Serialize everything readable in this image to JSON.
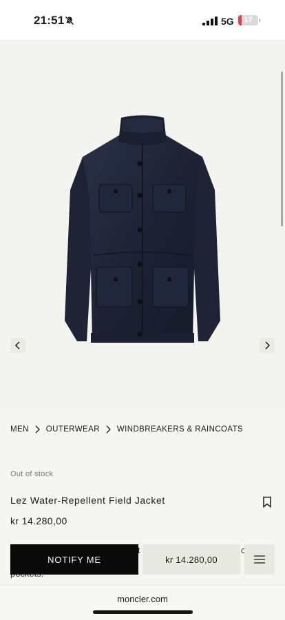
{
  "status_bar": {
    "time": "21:51",
    "network": "5G",
    "battery_level": 17,
    "battery_text": "17",
    "battery_color": "#e2444a"
  },
  "gallery": {
    "product_image": "navy-field-jacket",
    "prev_icon": "chevron-left-icon",
    "next_icon": "chevron-right-icon"
  },
  "breadcrumb": [
    "MEN",
    "OUTERWEAR",
    "WINDBREAKERS & RAINCOATS"
  ],
  "product": {
    "stock_status": "Out of stock",
    "title": "Lez Water-Repellent Field Jacket",
    "price": "kr 14.280,00",
    "description_peek_a": "pockets.",
    "description_peek_b": "t",
    "description_peek_c": "c"
  },
  "sticky_bar": {
    "notify_label": "NOTIFY ME",
    "price": "kr 14.280,00",
    "menu_icon": "hamburger-menu-icon"
  },
  "browser": {
    "url": "moncler.com"
  }
}
